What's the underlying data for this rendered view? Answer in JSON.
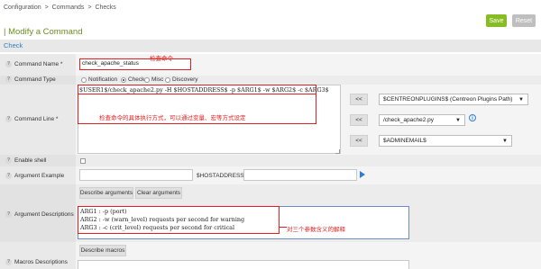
{
  "breadcrumb": [
    "Configuration",
    ">",
    "Commands",
    ">",
    "Checks"
  ],
  "toolbar": {
    "save_label": "Save",
    "reset_label": "Reset"
  },
  "page_title": "| Modify a Command",
  "section_title": "Check",
  "fields": {
    "command_name": {
      "label": "Command Name *",
      "value": "check_apache_status",
      "annotation": "检查命令"
    },
    "command_type": {
      "label": "Command Type",
      "options": [
        "Notification",
        "Check",
        "Misc",
        "Discovery"
      ],
      "selected": "Check"
    },
    "command_line": {
      "label": "Command Line *",
      "value": "$USER1$/check_apache2.py -H $HOSTADDRESS$ -p $ARG1$ -w $ARG2$ -c $ARG3$",
      "annotation": "检查命令的具体执行方式，可以通过变量、宏等方式设定",
      "move_label": "<<",
      "selects": [
        "$CENTREONPLUGINS$ (Centreon Plugins Path)",
        "/check_apache2.py",
        "$ADMINEMAIL$"
      ]
    },
    "enable_shell": {
      "label": "Enable shell"
    },
    "argument_example": {
      "label": "Argument Example",
      "host_label": "$HOSTADDRESS$"
    },
    "argument_buttons": {
      "describe": "Describe arguments",
      "clear": "Clear arguments"
    },
    "argument_descriptions": {
      "label": "Argument Descriptions",
      "lines": [
        "ARG1 : -p (port)",
        "ARG2 : -w (warn_level) requests per second for warning",
        "ARG3 : -c (crit_level) requests per second for critical"
      ],
      "annotation": "对三个参数含义的解释"
    },
    "macros": {
      "label": "Macros Descriptions",
      "button": "Describe macros"
    }
  },
  "colors": {
    "save": "#87bd23",
    "reset": "#bfbfbf",
    "title": "#6b8e23",
    "link": "#2f80c0",
    "annotation": "#e02020"
  }
}
